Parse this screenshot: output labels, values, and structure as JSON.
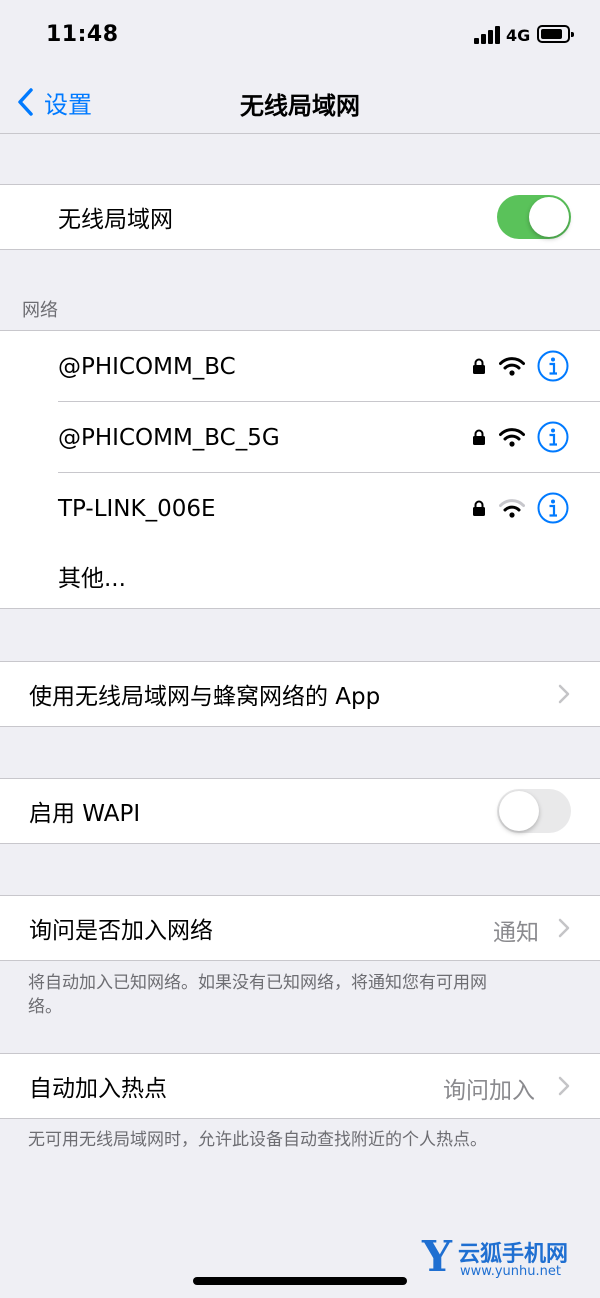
{
  "status_bar": {
    "time": "11:48",
    "network": "4G"
  },
  "nav": {
    "back_label": "设置",
    "title": "无线局域网"
  },
  "wifi_toggle": {
    "label": "无线局域网",
    "on": true
  },
  "networks_section": {
    "header": "网络",
    "networks": [
      {
        "name": "@PHICOMM_BC",
        "locked": true,
        "signal": "full"
      },
      {
        "name": "@PHICOMM_BC_5G",
        "locked": true,
        "signal": "full"
      },
      {
        "name": "TP-LINK_006E",
        "locked": true,
        "signal": "weak"
      }
    ],
    "other_label": "其他..."
  },
  "apps_row": {
    "label": "使用无线局域网与蜂窝网络的 App"
  },
  "wapi": {
    "label": "启用 WAPI",
    "on": false
  },
  "ask_join": {
    "label": "询问是否加入网络",
    "value": "通知",
    "footer": "将自动加入已知网络。如果没有已知网络，将通知您有可用网络。"
  },
  "auto_hotspot": {
    "label": "自动加入热点",
    "value": "询问加入",
    "footer": "无可用无线局域网时，允许此设备自动查找附近的个人热点。"
  },
  "watermark": {
    "letter": "Y",
    "name": "云狐手机网",
    "url": "www.yunhu.net"
  },
  "colors": {
    "accent": "#007aff",
    "toggle_on": "#5ac25a",
    "background": "#efeff4"
  }
}
